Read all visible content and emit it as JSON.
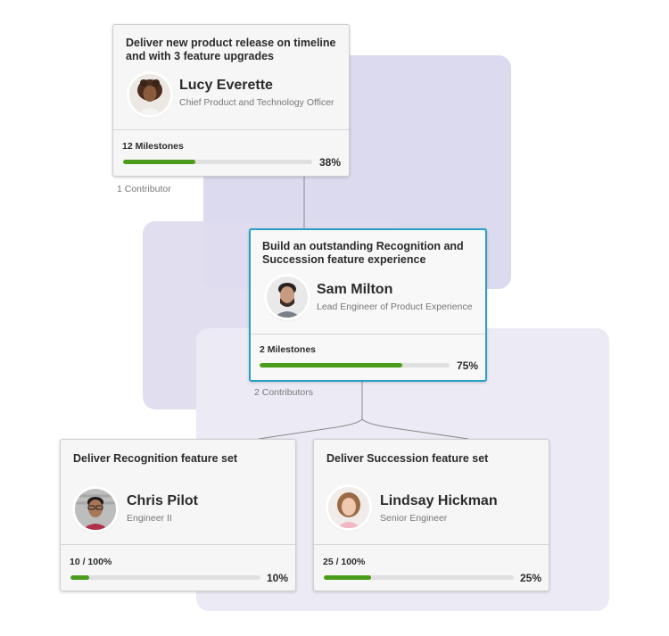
{
  "colors": {
    "accent": "#2a9fc5",
    "progress": "#4a9d1a",
    "progress_track": "#e0e0e0",
    "panel_primary": "#dcdaef",
    "panel_secondary": "#ecebf5"
  },
  "cards": [
    {
      "title": "Deliver new product release on timeline and with 3 feature upgrades",
      "name": "Lucy Everette",
      "role": "Chief Product and Technology Officer",
      "milestones": "12 Milestones",
      "progress": 0.38,
      "percent": "38%",
      "contributors": "1 Contributor",
      "avatar": "avatar-lucy-icon"
    },
    {
      "title": "Build an outstanding Recognition and Succession feature experience",
      "name": "Sam Milton",
      "role": "Lead Engineer of Product Experience",
      "milestones": "2 Milestones",
      "progress": 0.75,
      "percent": "75%",
      "contributors": "2 Contributors",
      "avatar": "avatar-sam-icon"
    },
    {
      "title": "Deliver Recognition feature set",
      "name": "Chris Pilot",
      "role": "Engineer II",
      "milestones": "10 / 100%",
      "progress": 0.1,
      "percent": "10%",
      "avatar": "avatar-chris-icon"
    },
    {
      "title": "Deliver Succession feature set",
      "name": "Lindsay Hickman",
      "role": "Senior Engineer",
      "milestones": "25 / 100%",
      "progress": 0.25,
      "percent": "25%",
      "avatar": "avatar-lindsay-icon"
    }
  ]
}
